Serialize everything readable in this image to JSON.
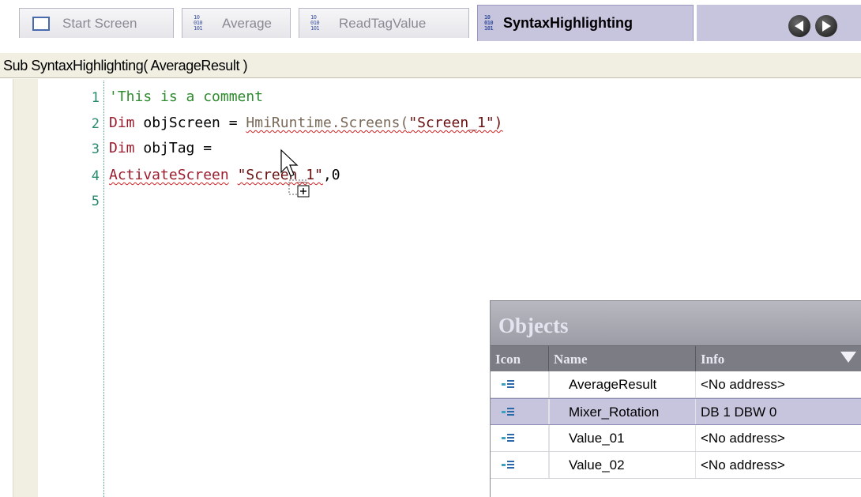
{
  "tabs": [
    {
      "label": "Start Screen",
      "icon": "screen-icon",
      "active": false
    },
    {
      "label": "Average",
      "icon": "script-icon",
      "active": false
    },
    {
      "label": "ReadTagValue",
      "icon": "script-icon",
      "active": false
    },
    {
      "label": "SyntaxHighlighting",
      "icon": "script-icon",
      "active": true
    }
  ],
  "nav": {
    "prev_icon": "arrow-left-icon",
    "next_icon": "arrow-right-icon"
  },
  "signature": "Sub SyntaxHighlighting( AverageResult )",
  "editor": {
    "line_numbers": [
      "1",
      "2",
      "3",
      "4",
      "5"
    ],
    "line1": {
      "comment": "'This is a comment"
    },
    "line2": {
      "kw": "Dim",
      "ident": " objScreen = ",
      "obj": "HmiRuntime.Screens(",
      "str": "\"Screen_1\")"
    },
    "line3": {
      "kw": "Dim",
      "ident": " objTag ="
    },
    "line4": {
      "fn": "ActivateScreen",
      "gap": " ",
      "str": "\"Screen_1\"",
      "rest": ",0"
    }
  },
  "objects_popup": {
    "title": "Objects",
    "headers": {
      "icon": "Icon",
      "name": "Name",
      "info": "Info"
    },
    "rows": [
      {
        "name": "AverageResult",
        "info": "<No address>",
        "selected": false
      },
      {
        "name": "Mixer_Rotation",
        "info": "DB 1 DBW 0",
        "selected": true
      },
      {
        "name": "Value_01",
        "info": "<No address>",
        "selected": false
      },
      {
        "name": "Value_02",
        "info": "<No address>",
        "selected": false
      }
    ]
  },
  "colors": {
    "active_tab": "#c7c5de",
    "comment": "#2e8b2e",
    "keyword": "#9c1c2e",
    "line_number": "#2a8a70"
  }
}
